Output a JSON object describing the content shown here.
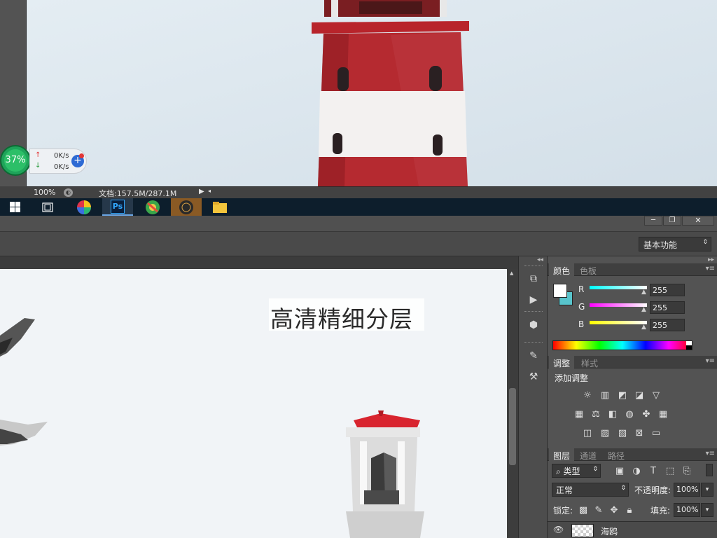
{
  "status_bar": {
    "zoom": "100%",
    "doc_info": "文档:157.5M/287.1M"
  },
  "net_widget": {
    "percent": "37%",
    "up_speed": "0K/s",
    "down_speed": "0K/s",
    "ring_color": "#1fa35a"
  },
  "taskbar": {
    "apps": [
      "windows-start",
      "task-view",
      "color-app",
      "photoshop",
      "browser",
      "media-app",
      "file-explorer"
    ],
    "ps_label": "Ps"
  },
  "options_bar": {
    "workspace": "基本功能"
  },
  "canvas": {
    "overlay_title": "高清精细分层"
  },
  "color_panel": {
    "tabs": [
      "颜色",
      "色板"
    ],
    "channels": [
      {
        "label": "R",
        "value": "255",
        "color": "#3fe3e3"
      },
      {
        "label": "G",
        "value": "255",
        "color": "#e23fe3"
      },
      {
        "label": "B",
        "value": "255",
        "color": "#e3e33f"
      }
    ]
  },
  "adjust_panel": {
    "tabs": [
      "调整",
      "样式"
    ],
    "heading": "添加调整"
  },
  "layers_panel": {
    "tabs": [
      "图层",
      "通道",
      "路径"
    ],
    "filter_kind": "类型",
    "blend_mode": "正常",
    "opacity_label": "不透明度:",
    "opacity_value": "100%",
    "lock_label": "锁定:",
    "fill_label": "填充:",
    "fill_value": "100%",
    "layers": [
      {
        "name": "海鸥",
        "visible": true
      }
    ]
  },
  "colors": {
    "accent": "#2d6ad4",
    "lighthouse_red": "#b5262c",
    "roof_red": "#d8242e"
  }
}
